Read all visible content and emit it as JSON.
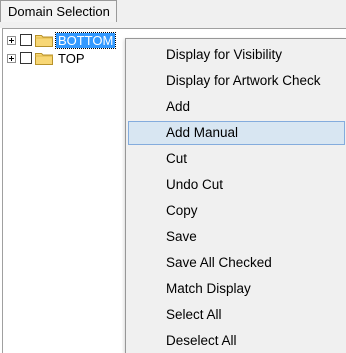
{
  "tabs": {
    "domain_selection_label": "Domain Selection"
  },
  "tree": {
    "items": [
      {
        "label": "BOTTOM",
        "selected": true,
        "checked": false
      },
      {
        "label": "TOP",
        "selected": false,
        "checked": false
      }
    ]
  },
  "context_menu": {
    "items": [
      {
        "label": "Display for Visibility"
      },
      {
        "label": "Display for Artwork Check"
      },
      {
        "label": "Add"
      },
      {
        "label": "Add Manual",
        "highlighted": true
      },
      {
        "label": "Cut"
      },
      {
        "label": "Undo Cut"
      },
      {
        "label": "Copy"
      },
      {
        "label": "Save"
      },
      {
        "label": "Save All Checked"
      },
      {
        "label": "Match Display"
      },
      {
        "label": "Select All"
      },
      {
        "label": "Deselect All"
      }
    ]
  },
  "colors": {
    "selection": "#3399ff",
    "menu_background": "#f0f0f0",
    "menu_highlight": "#d8e6f2",
    "menu_highlight_border": "#84acdd",
    "folder": "#f8d775"
  },
  "icons": {
    "expander": "plus-box-icon",
    "folder": "folder-icon",
    "checkbox": "checkbox-icon"
  }
}
